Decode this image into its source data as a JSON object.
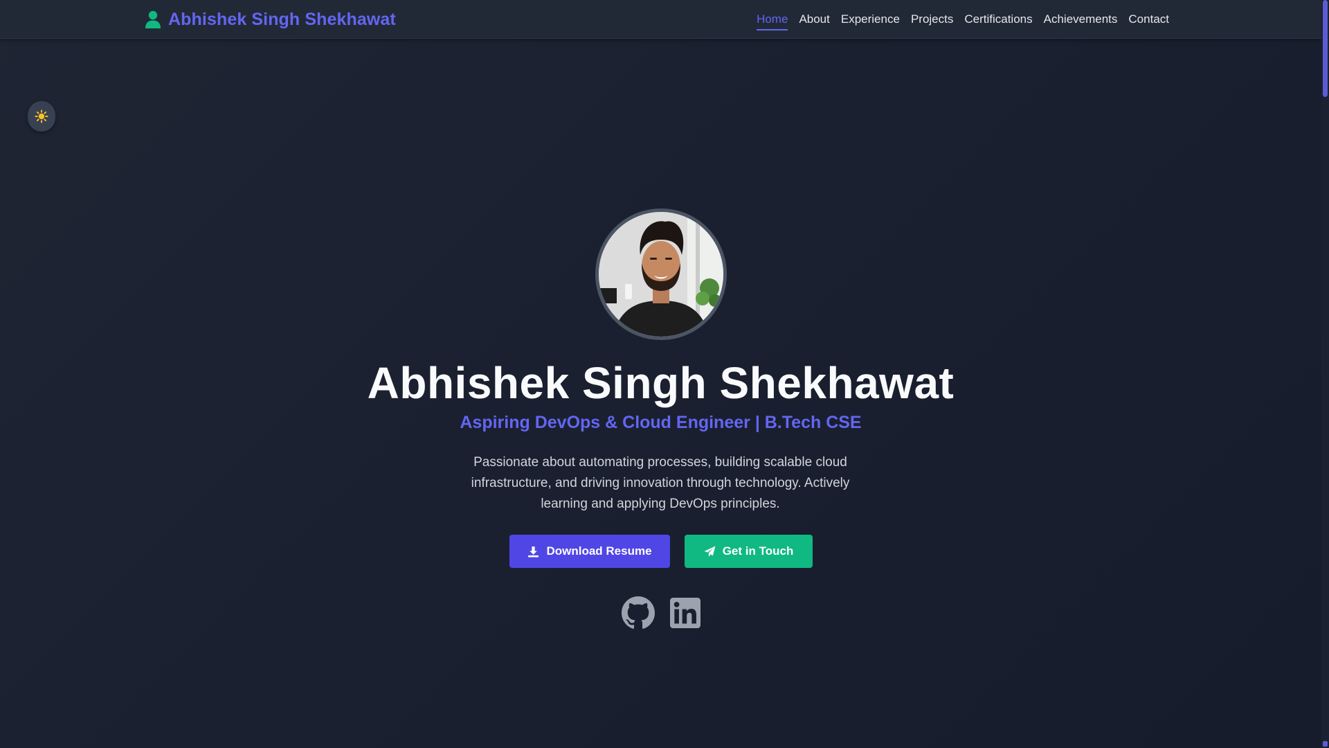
{
  "brand": {
    "name": "Abhishek Singh Shekhawat",
    "icon": "user-icon"
  },
  "nav": {
    "items": [
      {
        "label": "Home",
        "active": true
      },
      {
        "label": "About",
        "active": false
      },
      {
        "label": "Experience",
        "active": false
      },
      {
        "label": "Projects",
        "active": false
      },
      {
        "label": "Certifications",
        "active": false
      },
      {
        "label": "Achievements",
        "active": false
      },
      {
        "label": "Contact",
        "active": false
      }
    ]
  },
  "theme_toggle": {
    "icon": "sun-icon"
  },
  "hero": {
    "avatar_icon": "profile-photo",
    "title": "Abhishek Singh Shekhawat",
    "subtitle": "Aspiring DevOps & Cloud Engineer | B.Tech CSE",
    "description": "Passionate about automating processes, building scalable cloud infrastructure, and driving innovation through technology. Actively learning and applying DevOps principles.",
    "buttons": {
      "resume": {
        "label": "Download Resume",
        "icon": "download-icon"
      },
      "contact": {
        "label": "Get in Touch",
        "icon": "paper-plane-icon"
      }
    },
    "social": [
      {
        "name": "github-icon"
      },
      {
        "name": "linkedin-icon"
      }
    ]
  },
  "colors": {
    "accent": "#6366f1",
    "primary_button": "#4f46e5",
    "secondary_button": "#10b981",
    "brand_icon": "#10b981",
    "sun": "#fbbf24",
    "background": "#1a2030",
    "navbar": "#222936"
  }
}
